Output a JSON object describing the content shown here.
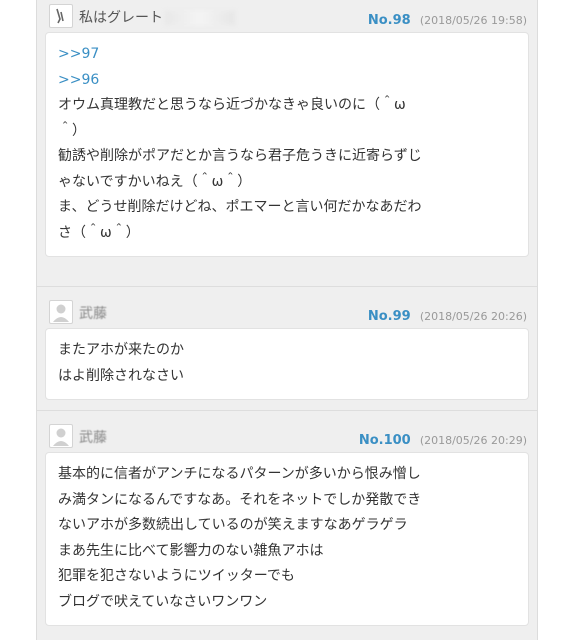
{
  "posts": [
    {
      "name": "私はグレート",
      "number": "No.98",
      "date": "(2018/05/26 19:58)",
      "anchors": [
        ">>97",
        ">>96"
      ],
      "lines": [
        "オウム真理教だと思うなら近づかなきゃ良いのに（＾ω",
        "＾）",
        "勧誘や削除がポアだとか言うなら君子危うきに近寄らずじ",
        "ゃないですかいねえ（＾ω＾）",
        "ま、どうせ削除だけどね、ポエマーと言い何だかなあだわ",
        "さ（＾ω＾）"
      ]
    },
    {
      "name": "武藤",
      "number": "No.99",
      "date": "(2018/05/26 20:26)",
      "lines": [
        "またアホが来たのか",
        "はよ削除されなさい"
      ]
    },
    {
      "name": "武藤",
      "number": "No.100",
      "date": "(2018/05/26 20:29)",
      "lines": [
        "基本的に信者がアンチになるパターンが多いから恨み憎し",
        "み満タンになるんですなあ。それをネットでしか発散でき",
        "ないアホが多数続出しているのが笑えますなあゲラゲラ",
        "まあ先生に比べて影響力のない雑魚アホは",
        "犯罪を犯さないようにツイッターでも",
        "ブログで吠えていなさいワンワン"
      ]
    }
  ],
  "icons": {
    "post_98_avatar": "user-avatar-icon",
    "post_99_avatar": "default-avatar-icon",
    "post_100_avatar": "default-avatar-icon"
  },
  "colors": {
    "post_number": "#3a8fc4",
    "anchor_link": "#3a8fc4",
    "date": "#999999",
    "thread_background": "#efefef",
    "post_body_background": "#ffffff"
  }
}
